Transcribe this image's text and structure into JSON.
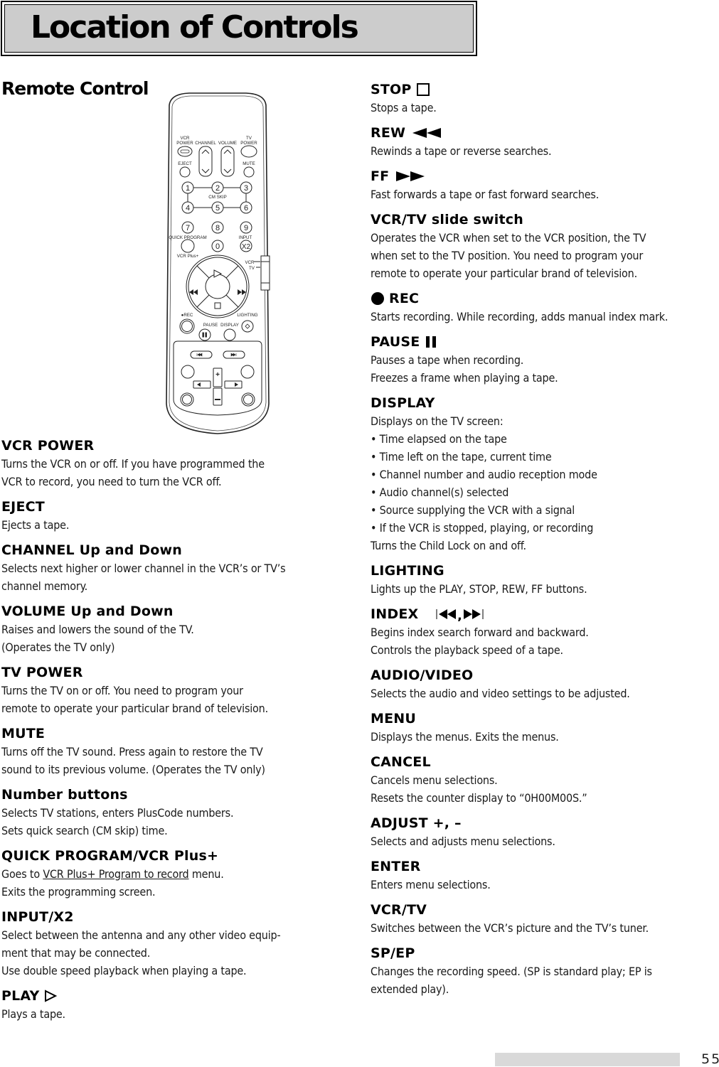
{
  "header": {
    "title": "Location of Controls"
  },
  "section": {
    "title": "Remote Control"
  },
  "remote_labels": {
    "vcr_power": [
      "VCR",
      "POWER"
    ],
    "channel": "CHANNEL",
    "volume": "VOLUME",
    "tv_power": [
      "TV",
      "POWER"
    ],
    "eject": "EJECT",
    "mute": "MUTE",
    "cm_skip": "CM SKIP",
    "quick_program": "QUICK PROGRAM",
    "input": "INPUT",
    "x2": "X2",
    "vcr_plus": "VCR Plus+",
    "vcr_switch": "VCR",
    "tv_switch": "TV",
    "play": "PLAY",
    "rew": "REW",
    "ff": "FF",
    "stop": "STOP",
    "rec": "●REC",
    "lighting": "LIGHTING",
    "pause": "PAUSE",
    "display": "DISPLAY",
    "index": "INDEX",
    "audio_video": "AUDIO/VIDEO",
    "adjust": "ADJUST",
    "menu": "MENU",
    "cancel": "CANCEL",
    "enter": "ENTER",
    "vcr_tv": "VCR/TV",
    "sp_ep": "SP/EP",
    "digits": [
      "1",
      "2",
      "3",
      "4",
      "5",
      "6",
      "7",
      "8",
      "9",
      "0"
    ]
  },
  "left_entries": [
    {
      "heading": "VCR POWER",
      "lines": [
        "Turns the VCR on or off.  If you have programmed the",
        "VCR to record, you need to turn the VCR off."
      ]
    },
    {
      "heading": "EJECT",
      "lines": [
        "Ejects a tape."
      ]
    },
    {
      "heading": "CHANNEL Up and Down",
      "lines": [
        "Selects next higher or lower channel in the VCR’s or TV’s",
        "channel memory."
      ]
    },
    {
      "heading": "VOLUME Up and Down",
      "lines": [
        "Raises and lowers the sound of the TV.",
        "(Operates the TV only)"
      ]
    },
    {
      "heading": "TV POWER",
      "lines": [
        "Turns the TV on or off. You need to program your",
        "remote to operate your particular brand of television."
      ]
    },
    {
      "heading": "MUTE",
      "lines": [
        "Turns off the TV sound.  Press again to restore the TV",
        "sound to its previous volume.  (Operates the TV only)"
      ]
    },
    {
      "heading": "Number buttons",
      "lines": [
        "Selects TV stations, enters PlusCode numbers.",
        "Sets quick search (CM skip) time."
      ]
    },
    {
      "heading": "QUICK PROGRAM/VCR Plus+",
      "lines_rich": {
        "before": "Goes to ",
        "link": "VCR Plus+ Program to record",
        "after": " menu."
      },
      "lines": [
        "Exits the programming screen."
      ]
    },
    {
      "heading": "INPUT/X2",
      "lines": [
        "Select between the antenna and any other video equip-",
        "ment that may be connected.",
        "Use double speed playback when playing a tape."
      ]
    },
    {
      "heading": "PLAY",
      "icon": "play-icon",
      "lines": [
        "Plays a tape."
      ]
    }
  ],
  "right_entries": [
    {
      "heading": "STOP",
      "icon": "stop-icon",
      "lines": [
        "Stops a tape."
      ]
    },
    {
      "heading": "REW",
      "icon": "rewind-icon",
      "lines": [
        "Rewinds a tape or reverse searches."
      ]
    },
    {
      "heading": "FF",
      "icon": "fast-forward-icon",
      "lines": [
        "Fast forwards a tape or fast forward searches."
      ]
    },
    {
      "heading": "VCR/TV slide switch",
      "lines": [
        "Operates the VCR when set to the VCR position, the TV",
        "when set to the TV position. You need to program your",
        "remote to operate your particular brand of television."
      ]
    },
    {
      "heading": "REC",
      "icon": "record-icon",
      "lines": [
        "Starts recording. While recording, adds manual index mark."
      ]
    },
    {
      "heading": "PAUSE",
      "icon": "pause-icon",
      "lines": [
        "Pauses a tape when recording.",
        "Freezes a frame when playing a tape."
      ]
    },
    {
      "heading": "DISPLAY",
      "lines": [
        "Displays on the TV screen:"
      ],
      "bullets": [
        "Time elapsed on the tape",
        "Time left on the tape, current time",
        "Channel number and audio reception mode",
        "Audio channel(s) selected",
        "Source supplying the VCR with a signal",
        "If the VCR is stopped, playing, or recording"
      ],
      "after": "Turns the Child Lock on and off."
    },
    {
      "heading": "LIGHTING",
      "lines": [
        "Lights up the PLAY, STOP, REW, FF buttons."
      ]
    },
    {
      "heading": "INDEX",
      "icon": "index-skip-icons",
      "lines": [
        "Begins index search forward and backward.",
        "Controls the playback speed of a tape."
      ]
    },
    {
      "heading": "AUDIO/VIDEO",
      "lines": [
        "Selects the audio and video settings to be adjusted."
      ]
    },
    {
      "heading": "MENU",
      "lines": [
        "Displays the menus.  Exits the menus."
      ]
    },
    {
      "heading": "CANCEL",
      "lines": [
        "Cancels menu selections.",
        "Resets the counter display to “0H00M00S.”"
      ]
    },
    {
      "heading": "ADJUST +, –",
      "lines": [
        "Selects and adjusts menu selections."
      ]
    },
    {
      "heading": "ENTER",
      "lines": [
        "Enters menu selections."
      ]
    },
    {
      "heading": "VCR/TV",
      "lines": [
        "Switches between the VCR’s picture and the TV’s tuner."
      ]
    },
    {
      "heading": "SP/EP",
      "lines": [
        "Changes the recording speed.  (SP is standard play; EP is",
        "extended play)."
      ]
    }
  ],
  "footer": {
    "page_number": "55"
  }
}
